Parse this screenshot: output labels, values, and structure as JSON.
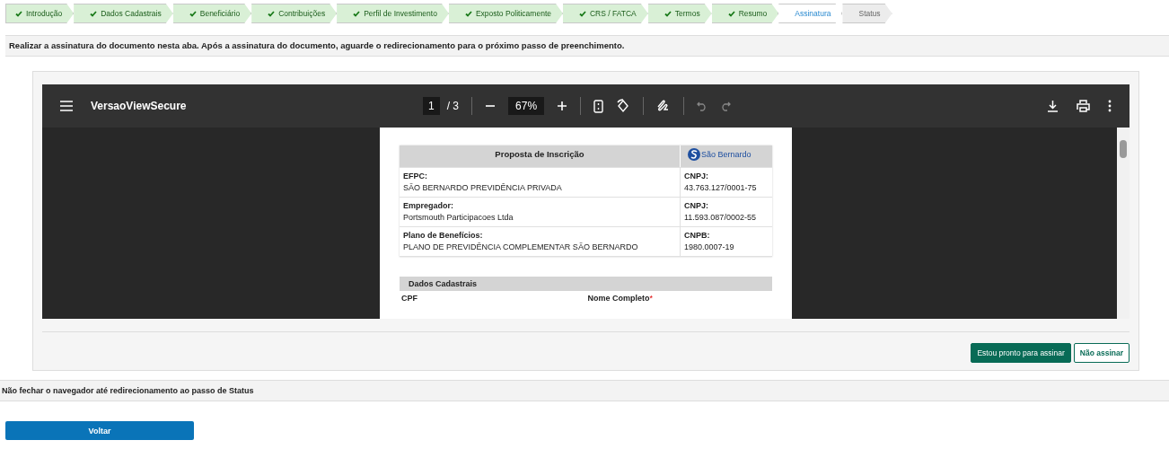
{
  "steps": [
    {
      "label": "Introdução",
      "done": true,
      "selected": false
    },
    {
      "label": "Dados Cadastrais",
      "done": true,
      "selected": false
    },
    {
      "label": "Beneficiário",
      "done": true,
      "selected": false
    },
    {
      "label": "Contribuições",
      "done": true,
      "selected": false
    },
    {
      "label": "Perfil de Investimento",
      "done": true,
      "selected": false
    },
    {
      "label": "Exposto Politicamente",
      "done": true,
      "selected": false
    },
    {
      "label": "CRS / FATCA",
      "done": true,
      "selected": false
    },
    {
      "label": "Termos",
      "done": true,
      "selected": false
    },
    {
      "label": "Resumo",
      "done": true,
      "selected": false
    },
    {
      "label": "Assinatura",
      "done": false,
      "selected": true
    },
    {
      "label": "Status",
      "done": false,
      "selected": false
    }
  ],
  "instruction": "Realizar a assinatura do documento nesta aba. Após a assinatura do documento, aguarde o redirecionamento para o próximo passo de preenchimento.",
  "viewer": {
    "title": "VersaoViewSecure",
    "page": "1",
    "page_total": "/ 3",
    "zoom": "67%",
    "document": {
      "title": "Proposta de Inscrição",
      "logo_text": "São Bernardo",
      "rows": [
        {
          "label": "EFPC:",
          "value": "SÃO BERNARDO PREVIDÊNCIA PRIVADA",
          "side_label": "CNPJ:",
          "side_value": "43.763.127/0001-75"
        },
        {
          "label": "Empregador:",
          "value": "Portsmouth Participacoes Ltda",
          "side_label": "CNPJ:",
          "side_value": "11.593.087/0002-55"
        },
        {
          "label": "Plano de Benefícios:",
          "value": "PLANO DE PREVIDÊNCIA COMPLEMENTAR SÃO BERNARDO",
          "side_label": "CNPB:",
          "side_value": "1980.0007-19"
        }
      ],
      "section": "Dados Cadastrais",
      "fields": [
        {
          "label": "CPF"
        },
        {
          "label": "Nome Completo",
          "required_mark": "*"
        }
      ]
    }
  },
  "buttons": [
    {
      "label": "Estou pronto para assinar",
      "kind": "primary"
    },
    {
      "label": "Não assinar",
      "kind": "outline"
    }
  ],
  "notice": "Não fechar o navegador até redirecionamento ao passo de Status",
  "back_button": "Voltar"
}
